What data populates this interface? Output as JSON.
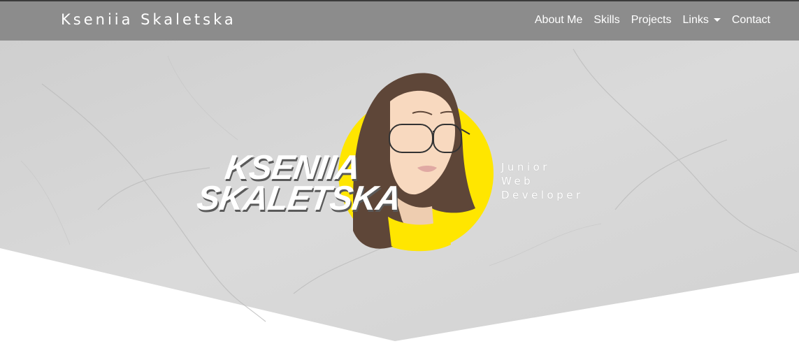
{
  "navbar": {
    "brand": "Kseniia Skaletska",
    "items": [
      {
        "label": "About Me"
      },
      {
        "label": "Skills"
      },
      {
        "label": "Projects"
      },
      {
        "label": "Links"
      },
      {
        "label": "Contact"
      }
    ]
  },
  "hero": {
    "logo_name_line1": "KSENIIA",
    "logo_name_line2": "SKALETSKA",
    "tagline": [
      "Junior",
      "Web",
      "Developer"
    ]
  },
  "colors": {
    "navbar_bg": "#8c8c8c",
    "hero_marble": "#d9d9d9",
    "avatar_circle": "#ffe600",
    "hair": "#5e4638",
    "skin": "#f8d9bf"
  },
  "icons": {
    "dropdown": "caret-down-icon",
    "avatar": "avatar-illustration"
  }
}
